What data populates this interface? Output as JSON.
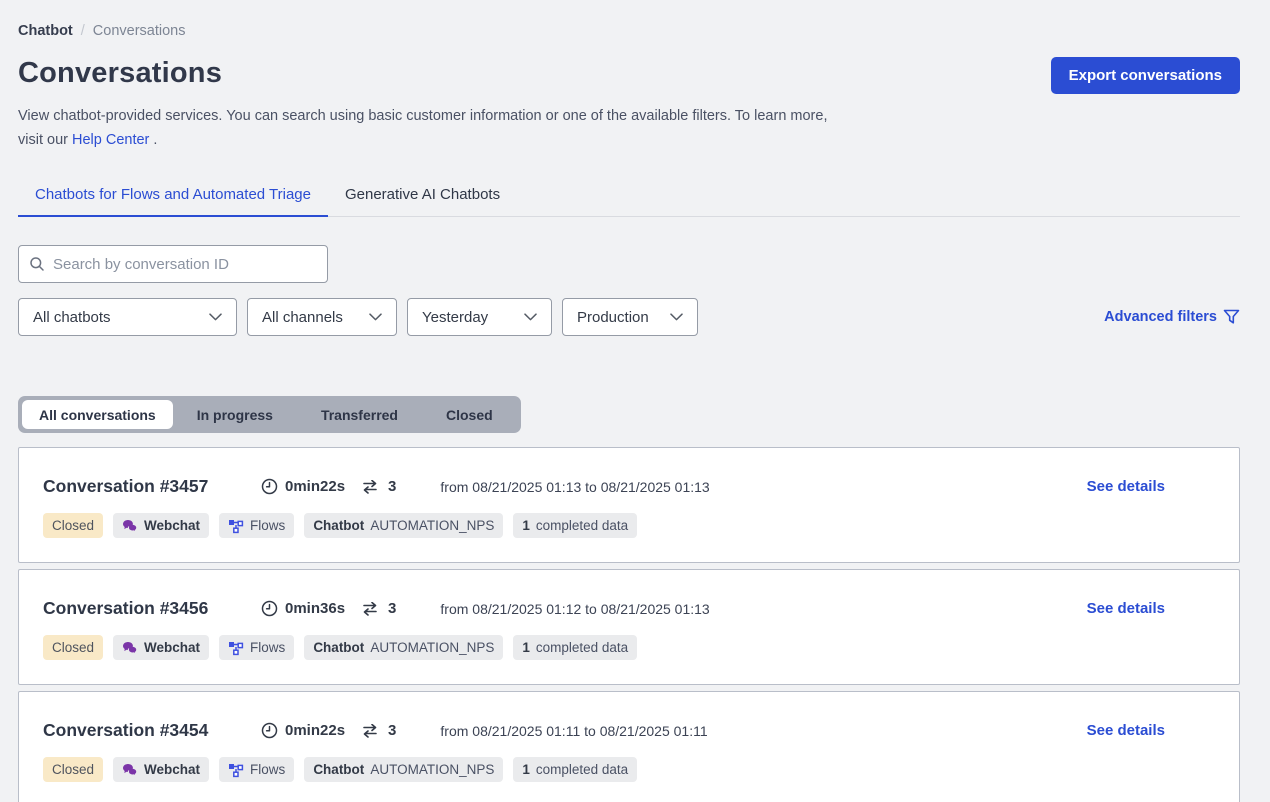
{
  "breadcrumb": {
    "root": "Chatbot",
    "separator": "/",
    "current": "Conversations"
  },
  "header": {
    "title": "Conversations",
    "export_button": "Export conversations"
  },
  "description": {
    "line1": "View chatbot-provided services. You can search using basic customer information or one of the available filters. To learn more,",
    "line2_prefix": "visit our ",
    "link_text": "Help Center",
    "line2_suffix": " ."
  },
  "tabs": [
    {
      "label": "Chatbots for Flows and Automated Triage",
      "active": true
    },
    {
      "label": "Generative AI Chatbots",
      "active": false
    }
  ],
  "search": {
    "placeholder": "Search by conversation ID"
  },
  "filters": {
    "dropdowns": [
      {
        "value": "All chatbots"
      },
      {
        "value": "All channels"
      },
      {
        "value": "Yesterday"
      },
      {
        "value": "Production"
      }
    ],
    "advanced_label": "Advanced filters"
  },
  "status_tabs": [
    {
      "label": "All conversations",
      "active": true
    },
    {
      "label": "In progress",
      "active": false
    },
    {
      "label": "Transferred",
      "active": false
    },
    {
      "label": "Closed",
      "active": false
    }
  ],
  "conversations": [
    {
      "title": "Conversation #3457",
      "duration": "0min22s",
      "exchanges": "3",
      "date_range": "from 08/21/2025 01:13 to 08/21/2025 01:13",
      "see_details": "See details",
      "status_badge": "Closed",
      "channel_badge": "Webchat",
      "flows_badge": "Flows",
      "chatbot_label": "Chatbot",
      "chatbot_name": "AUTOMATION_NPS",
      "completed_count": "1",
      "completed_label": "completed data"
    },
    {
      "title": "Conversation #3456",
      "duration": "0min36s",
      "exchanges": "3",
      "date_range": "from 08/21/2025 01:12 to 08/21/2025 01:13",
      "see_details": "See details",
      "status_badge": "Closed",
      "channel_badge": "Webchat",
      "flows_badge": "Flows",
      "chatbot_label": "Chatbot",
      "chatbot_name": "AUTOMATION_NPS",
      "completed_count": "1",
      "completed_label": "completed data"
    },
    {
      "title": "Conversation #3454",
      "duration": "0min22s",
      "exchanges": "3",
      "date_range": "from 08/21/2025 01:11 to 08/21/2025 01:11",
      "see_details": "See details",
      "status_badge": "Closed",
      "channel_badge": "Webchat",
      "flows_badge": "Flows",
      "chatbot_label": "Chatbot",
      "chatbot_name": "AUTOMATION_NPS",
      "completed_count": "1",
      "completed_label": "completed data"
    }
  ],
  "colors": {
    "accent_blue": "#2b4dd3",
    "webchat_purple": "#7b35a8",
    "flows_blue": "#3f51e0",
    "closed_badge_bg": "#f9e9c7",
    "page_bg": "#f1f2f4"
  }
}
